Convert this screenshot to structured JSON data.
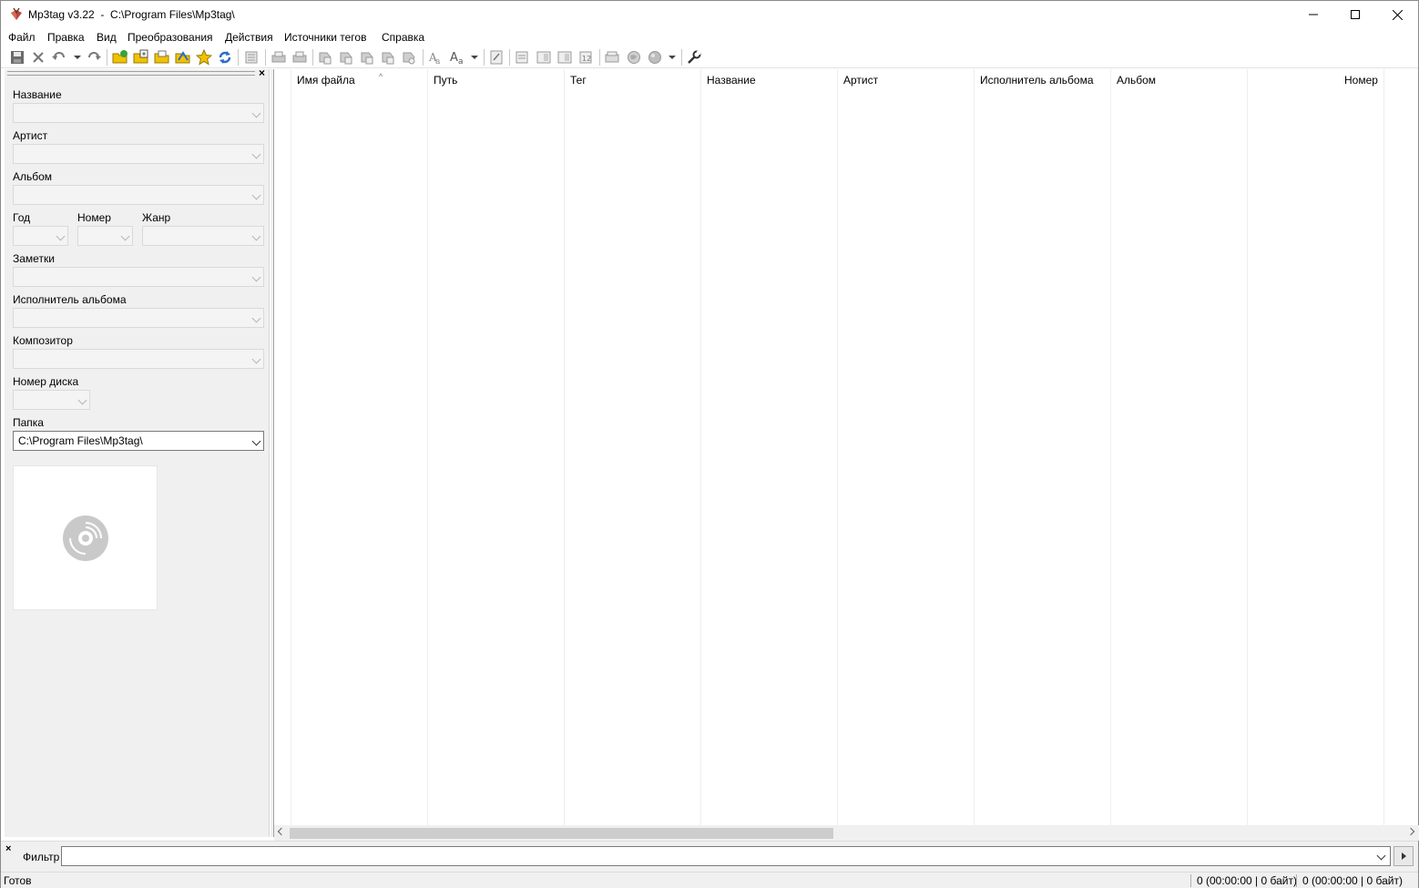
{
  "window": {
    "app_name": "Mp3tag v3.22",
    "title": "Mp3tag v3.22  -  C:\\Program Files\\Mp3tag\\"
  },
  "menu": [
    "Файл",
    "Правка",
    "Вид",
    "Преобразования",
    "Действия",
    "Источники тегов",
    "Справка"
  ],
  "toolbar_icons": [
    "save-icon",
    "remove-tag-icon",
    "undo-icon",
    "redo-icon",
    "change-directory-icon",
    "add-directory-icon",
    "open-folder-icon",
    "favorite-folder-icon",
    "star-icon",
    "refresh-icon",
    "tag-panel-icon",
    "print-icon",
    "export-icon",
    "tag-filename-icon",
    "filename-tag-icon",
    "text-tag-icon",
    "tag-tag-icon",
    "autonumber-icon",
    "case-convert-icon",
    "text-style-icon",
    "edit-playlist-icon",
    "extended-tags-icon",
    "tag-sources-icon",
    "web-sources-icon",
    "actions-icon",
    "settings-icon"
  ],
  "tag_panel": {
    "fields": {
      "title_label": "Название",
      "artist_label": "Артист",
      "album_label": "Альбом",
      "year_label": "Год",
      "track_label": "Номер",
      "genre_label": "Жанр",
      "comment_label": "Заметки",
      "album_artist_label": "Исполнитель альбома",
      "composer_label": "Композитор",
      "disc_label": "Номер диска",
      "folder_label": "Папка"
    },
    "folder_value": "C:\\Program Files\\Mp3tag\\",
    "cover_icon": "cd-disc-icon"
  },
  "file_list": {
    "columns": [
      "Имя файла",
      "Путь",
      "Тег",
      "Название",
      "Артист",
      "Исполнитель альбома",
      "Альбом",
      "Номер"
    ],
    "sorted_column": "Имя файла",
    "rows": []
  },
  "filter": {
    "label": "Фильтр",
    "value": ""
  },
  "status": {
    "text": "Готов",
    "selected": "0 (00:00:00 | 0 байт)",
    "total": "0 (00:00:00 | 0 байт)"
  },
  "colors": {
    "panel_bg": "#f0f0f0",
    "accent_yellow": "#f2c200",
    "accent_green": "#3aa23a",
    "accent_blue": "#2a6cc7"
  }
}
